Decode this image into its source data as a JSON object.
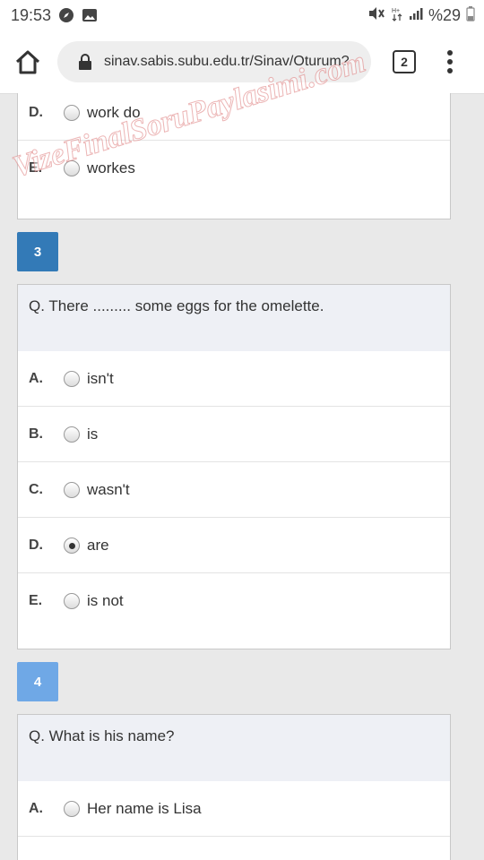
{
  "status_bar": {
    "time": "19:53",
    "battery": "%29"
  },
  "browser": {
    "url": "sinav.sabis.subu.edu.tr/Sinav/Oturum?",
    "tab_count": "2"
  },
  "question2_partial": {
    "options": [
      {
        "letter": "D.",
        "text": "work do"
      },
      {
        "letter": "E.",
        "text": "workes"
      }
    ]
  },
  "question3": {
    "number": "3",
    "badge_color": "#337ab7",
    "question": "Q. There ......... some eggs for the omelette.",
    "options": [
      {
        "letter": "A.",
        "text": "isn't",
        "selected": false
      },
      {
        "letter": "B.",
        "text": "is",
        "selected": false
      },
      {
        "letter": "C.",
        "text": "wasn't",
        "selected": false
      },
      {
        "letter": "D.",
        "text": "are",
        "selected": true
      },
      {
        "letter": "E.",
        "text": "is not",
        "selected": false
      }
    ]
  },
  "question4": {
    "number": "4",
    "badge_color": "#6fa8e6",
    "question": "Q. What is his name?",
    "options": [
      {
        "letter": "A.",
        "text": "Her name is Lisa",
        "selected": false
      }
    ]
  },
  "watermark": "VizeFinalSoruPaylasimi.com"
}
